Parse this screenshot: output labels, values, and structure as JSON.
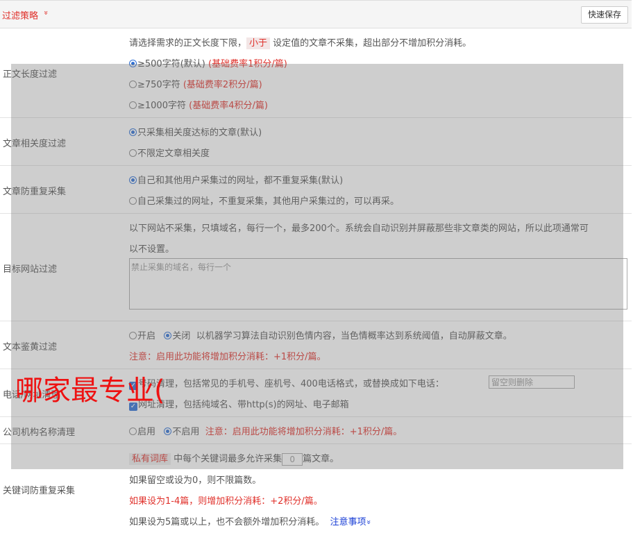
{
  "header": {
    "title": "过滤策略",
    "chevron": "»",
    "save_label": "快速保存"
  },
  "length_filter": {
    "label": "正文长度过滤",
    "desc_pre": "请选择需求的正文长度下限，",
    "desc_tag": "小于",
    "desc_post": "设定值的文章不采集，超出部分不增加积分消耗。",
    "options": [
      {
        "text": "≥500字符(默认)",
        "note": "(基础费率1积分/篇)",
        "checked": true
      },
      {
        "text": "≥750字符",
        "note": "(基础费率2积分/篇)",
        "checked": false
      },
      {
        "text": "≥1000字符",
        "note": "(基础费率4积分/篇)",
        "checked": false
      }
    ]
  },
  "relevance": {
    "label": "文章相关度过滤",
    "options": [
      {
        "text": "只采集相关度达标的文章(默认)",
        "checked": true
      },
      {
        "text": "不限定文章相关度",
        "checked": false
      }
    ]
  },
  "dedup": {
    "label": "文章防重复采集",
    "options": [
      {
        "text": "自己和其他用户采集过的网址，都不重复采集(默认)",
        "checked": true
      },
      {
        "text": "自己采集过的网址，不重复采集，其他用户采集过的，可以再采。",
        "checked": false
      }
    ]
  },
  "site_filter": {
    "label": "目标网站过滤",
    "desc1": "以下网站不采集，只填域名，每行一个，最多200个。系统会自动识别并屏蔽那些非文章类的网站，所以此项通常可",
    "desc2": "以不设置。",
    "placeholder": "禁止采集的域名，每行一个"
  },
  "porn_filter": {
    "label": "文本鉴黄过滤",
    "on_label": "开启",
    "off_label": "关闭",
    "desc": "以机器学习算法自动识别色情内容，当色情概率达到系统阈值，自动屏蔽文章。",
    "note": "注意：启用此功能将增加积分消耗：+1积分/篇。"
  },
  "phone_filter": {
    "label": "电话/网址清理",
    "phone_text": "号码清理，包括常见的手机号、座机号、400电话格式，或替换成如下电话：",
    "phone_placeholder": "留空则删除",
    "url_text": "网址清理，包括纯域名、带http(s)的网址、电子邮箱"
  },
  "org_filter": {
    "label": "公司机构名称清理",
    "on_label": "启用",
    "off_label": "不启用",
    "note": "注意：启用此功能将增加积分消耗：+1积分/篇。"
  },
  "keyword_dedup": {
    "label": "关键词防重复采集",
    "tag": "私有词库",
    "line1_mid": "中每个关键词最多允许采集",
    "value": "0",
    "line1_post": "篇文章。",
    "line2": "如果留空或设为0，则不限篇数。",
    "line3": "如果设为1-4篇，则增加积分消耗：+2积分/篇。",
    "line4": "如果设为5篇或以上，也不会额外增加积分消耗。",
    "link": "注意事项",
    "link_icon": "»"
  },
  "watermark": "哪家最专业(",
  "colors": {
    "accent": "#e0312b",
    "radio": "#2d6fd6",
    "link": "#1a3fd6"
  }
}
